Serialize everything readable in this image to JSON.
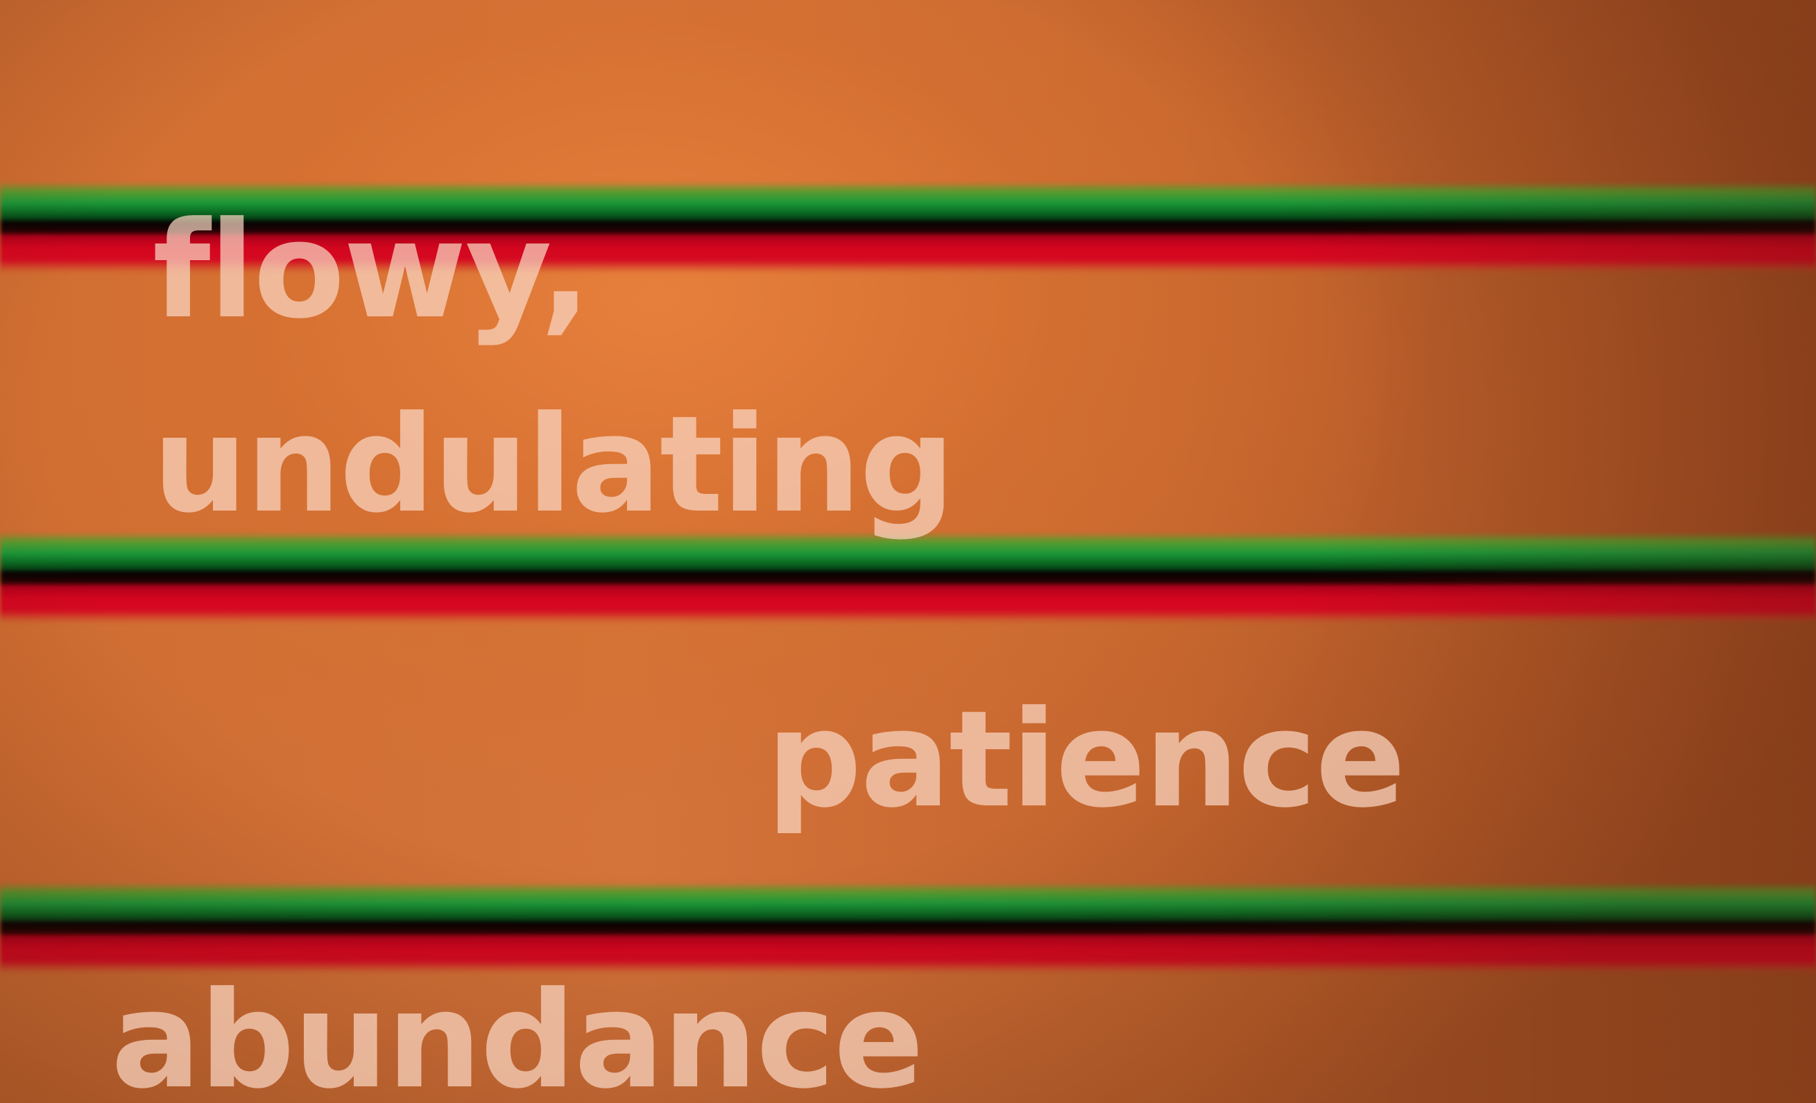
{
  "words": {
    "line1": "flowy,",
    "line2": "undulating",
    "line3": "patience",
    "line4": "abundance"
  },
  "colors": {
    "background": "#c96a30",
    "stripe_green": "#1d9a3a",
    "stripe_red": "#d4061e",
    "stripe_dark": "#020202",
    "text": "#f6d2c0"
  }
}
